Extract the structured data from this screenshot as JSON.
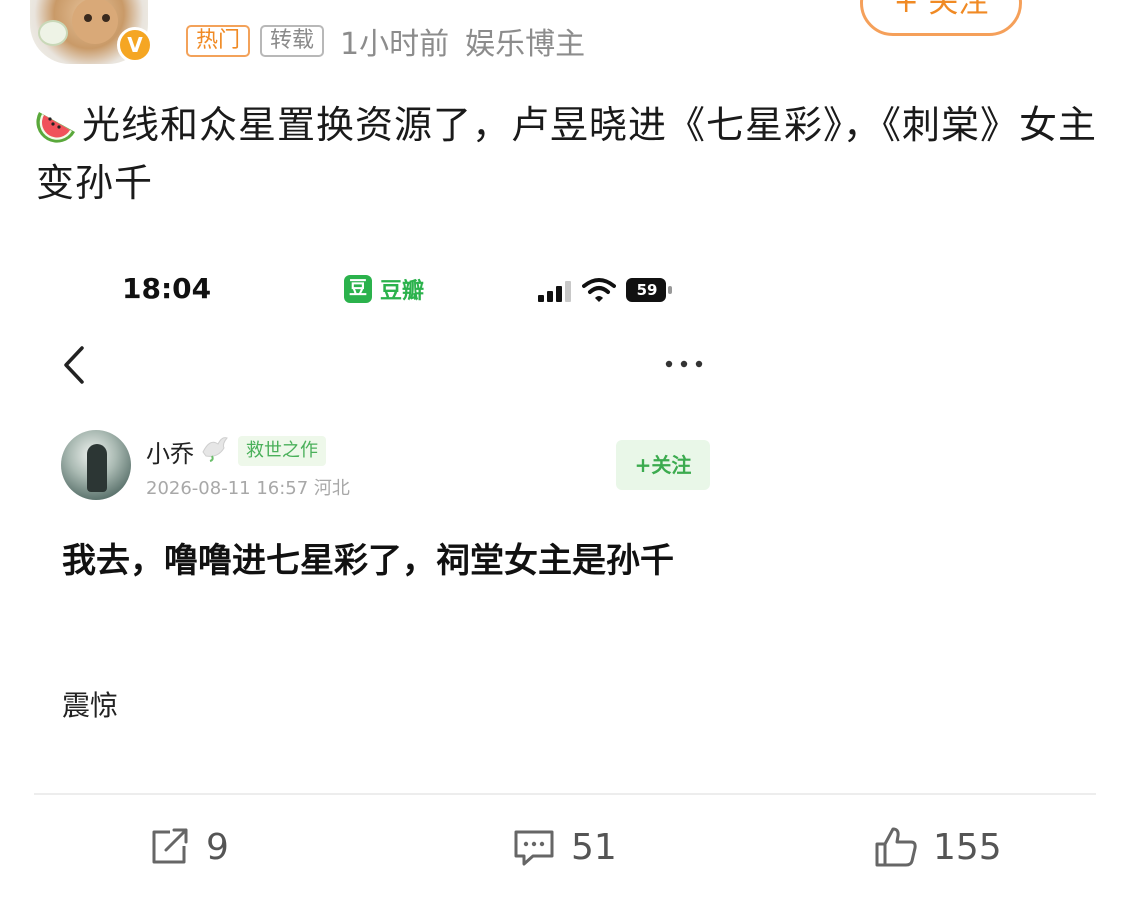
{
  "post": {
    "tags": {
      "hot": "热门",
      "repost": "转载"
    },
    "time": "1小时前",
    "source": "娱乐博主",
    "follow_label": "+ 关注",
    "verified_mark": "V",
    "text": "光线和众星置换资源了，卢昱晓进《七星彩》，《刺棠》女主变孙千"
  },
  "embedded": {
    "status_time": "18:04",
    "app_logo": "豆",
    "app_name": "豆瓣",
    "battery": "59",
    "author": {
      "name": "小乔",
      "badge": "救世之作",
      "timestamp": "2026-08-11 16:57 河北"
    },
    "follow_label": "+关注",
    "title": "我去，噜噜进七星彩了，祠堂女主是孙千",
    "body": "震惊"
  },
  "actions": {
    "repost_count": "9",
    "comment_count": "51",
    "like_count": "155"
  },
  "colors": {
    "accent_orange": "#f08a24",
    "douban_green": "#2bb24c"
  }
}
